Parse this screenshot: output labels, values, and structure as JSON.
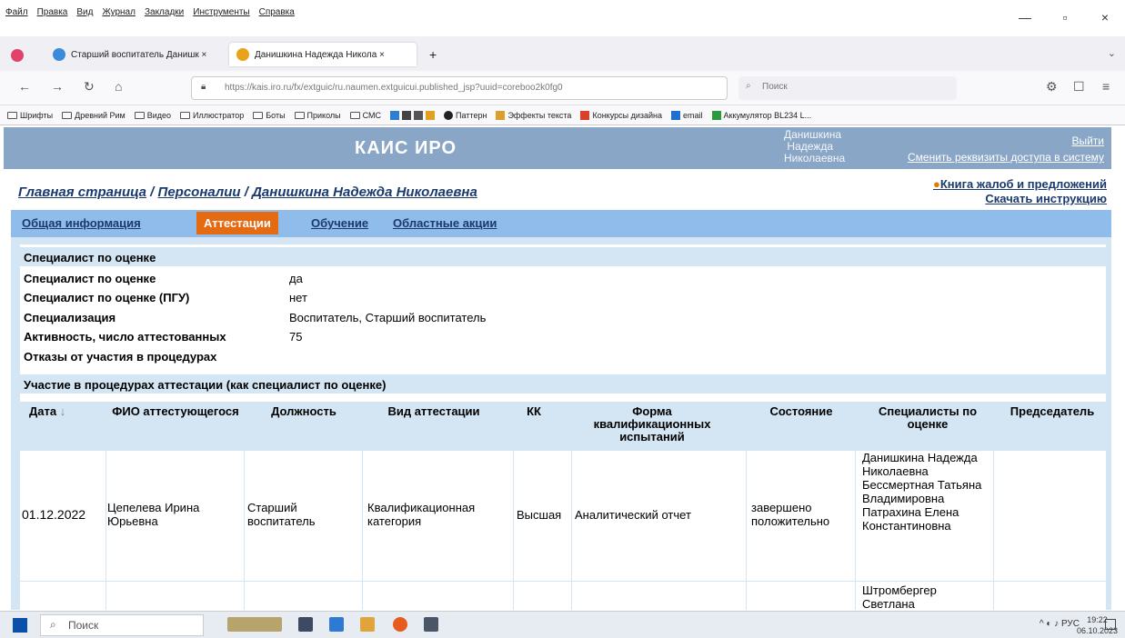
{
  "browser": {
    "menu": [
      "Файл",
      "Правка",
      "Вид",
      "Журнал",
      "Закладки",
      "Инструменты",
      "Справка"
    ],
    "tabs": [
      {
        "label": "Старший воспитатель Данишк ×",
        "active": false
      },
      {
        "label": "Данишкина Надежда Никола ×",
        "active": true
      }
    ],
    "new_tab": "+",
    "url": "https://kais.iro.ru/fx/extguic/ru.naumen.extguicui.published_jsp?uuid=coreboo2k0fg0",
    "search_placeholder": "Поиск",
    "bookmarks": [
      "Шрифты",
      "Древний Рим",
      "Видео",
      "Иллюстратор",
      "Боты",
      "Приколы",
      "СМС",
      "Паттерн",
      "Эффекты текста",
      "Конкурсы дизайна",
      "email",
      "Аккумулятор BL234 L..."
    ]
  },
  "header": {
    "title": "КАИС ИРО",
    "user": [
      "Данишкина",
      "Надежда",
      "Николаевна"
    ],
    "logout": "Выйти",
    "change": "Сменить реквизиты доступа в систему"
  },
  "breadcrumbs": {
    "home": "Главная страница",
    "sep": " / ",
    "personnel": "Персоналии",
    "person": "Данишкина Надежда Николаевна"
  },
  "links": {
    "complaints": "Книга жалоб и предложений",
    "manual": "Скачать инструкцию"
  },
  "subtabs": [
    "Общая информация",
    "Аттестации",
    "Обучение",
    "Областные акции"
  ],
  "section1": {
    "title": "Специалист по оценке",
    "rows": [
      {
        "label": "Специалист по оценке",
        "value": "да"
      },
      {
        "label": "Специалист по оценке (ПГУ)",
        "value": "нет"
      },
      {
        "label": "Специализация",
        "value": "Воспитатель, Старший воспитатель"
      },
      {
        "label": "Активность, число аттестованных",
        "value": "75"
      },
      {
        "label": "Отказы от участия в процедурах",
        "value": ""
      }
    ]
  },
  "section2": {
    "title": "Участие в процедурах аттестации (как специалист по оценке)",
    "columns": [
      "Дата",
      "ФИО аттестующегося",
      "Должность",
      "Вид аттестации",
      "КК",
      "Форма квалификационных испытаний",
      "Состояние",
      "Специалисты по оценке",
      "Председатель"
    ],
    "sort_mark": "↓",
    "rows": [
      {
        "date": "01.12.2022",
        "name": "Цепелева Ирина Юрьевна",
        "position": "Старший воспитатель",
        "type": "Квалификационная категория",
        "kk": "Высшая",
        "form": "Аналитический отчет",
        "state": "завершено положительно",
        "experts": "Данишкина Надежда Николаевна Бессмертная Татьяна Владимировна Патрахина Елена Константиновна",
        "chair": ""
      },
      {
        "date": "",
        "name": "",
        "position": "",
        "type": "",
        "kk": "",
        "form": "",
        "state": "",
        "experts": "Штромбергер Светлана",
        "chair": ""
      }
    ]
  },
  "taskbar": {
    "search": "Поиск",
    "lang": "РУС",
    "time": "19:22",
    "date": "06.10.2023"
  },
  "colors": {
    "header": "#8aa6c6",
    "subtabs": "#8fbcea",
    "active_tab": "#e56b12",
    "panel": "#d4e6f3",
    "link": "#1a3a6e"
  }
}
